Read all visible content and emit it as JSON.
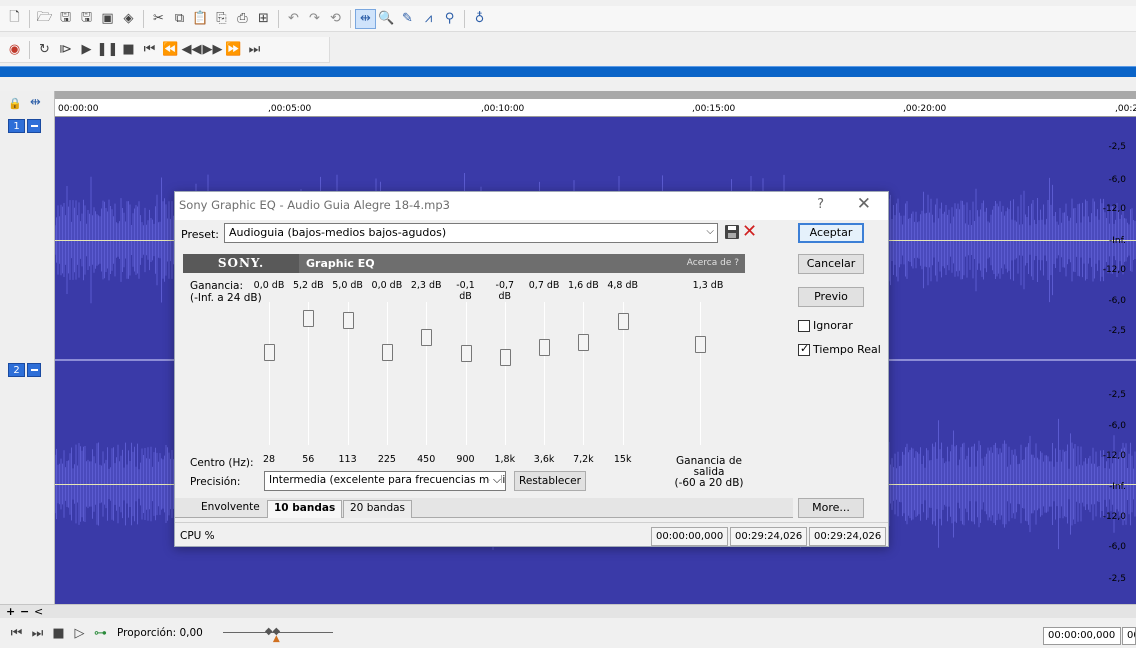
{
  "toolbar1": {
    "icons": [
      "new-icon",
      "open-icon",
      "save-icon",
      "save-as-icon",
      "render-icon",
      "properties-icon",
      "cut-icon",
      "copy-icon",
      "paste-icon",
      "paste-insert-icon",
      "mix-icon",
      "crop-icon",
      "undo-icon",
      "redo-icon",
      "undo-history-icon",
      "edit-tool-icon",
      "zoom-tool-icon",
      "pencil-tool-icon",
      "envelope-tool-icon",
      "region-icon",
      "marker-icon"
    ]
  },
  "toolbar2": {
    "icons": [
      "record-icon",
      "loop-icon",
      "play-all-icon",
      "play-icon",
      "pause-icon",
      "stop-icon",
      "go-start-icon",
      "prev-marker-icon",
      "rewind-icon",
      "forward-icon",
      "next-marker-icon",
      "go-end-icon"
    ]
  },
  "ruler": {
    "labels": [
      "00:00:00",
      ",00:05:00",
      ",00:10:00",
      ",00:15:00",
      ",00:20:00",
      ",00:2"
    ]
  },
  "channels": [
    {
      "number": "1",
      "db_labels": [
        "-2,5",
        "-6,0",
        "-12,0",
        "-Inf.",
        "-12,0",
        "-6,0",
        "-2,5"
      ]
    },
    {
      "number": "2",
      "db_labels": [
        "-2,5",
        "-6,0",
        "-12,0",
        "-Inf.",
        "-12,0",
        "-6,0",
        "-2,5"
      ]
    }
  ],
  "dialog": {
    "title": "Sony Graphic EQ - Audio Guia Alegre 18-4.mp3",
    "help_glyph": "?",
    "close_glyph": "✕",
    "preset_label": "Preset:",
    "preset_value": "Audioguia (bajos-medios bajos-agudos)",
    "buttons": {
      "accept": "Aceptar",
      "cancel": "Cancelar",
      "preview": "Previo",
      "more": "More..."
    },
    "checkboxes": {
      "ignore": {
        "label": "Ignorar",
        "checked": false
      },
      "realtime": {
        "label": "Tiempo Real",
        "checked": true
      }
    },
    "plugin": {
      "brand": "SONY.",
      "name": "Graphic EQ",
      "about": "Acerca de  ?",
      "gain_label_1": "Ganancia:",
      "gain_label_2": "(-Inf. a 24 dB)",
      "bands": [
        {
          "gain": "0,0 dB",
          "gain_value": 0.0,
          "freq": "28"
        },
        {
          "gain": "5,2 dB",
          "gain_value": 5.2,
          "freq": "56"
        },
        {
          "gain": "5,0 dB",
          "gain_value": 5.0,
          "freq": "113"
        },
        {
          "gain": "0,0 dB",
          "gain_value": 0.0,
          "freq": "225"
        },
        {
          "gain": "2,3 dB",
          "gain_value": 2.3,
          "freq": "450"
        },
        {
          "gain": "-0,1 dB",
          "gain_value": -0.1,
          "freq": "900"
        },
        {
          "gain": "-0,7 dB",
          "gain_value": -0.7,
          "freq": "1,8k"
        },
        {
          "gain": "0,7 dB",
          "gain_value": 0.7,
          "freq": "3,6k"
        },
        {
          "gain": "1,6 dB",
          "gain_value": 1.6,
          "freq": "7,2k"
        },
        {
          "gain": "4,8 dB",
          "gain_value": 4.8,
          "freq": "15k"
        }
      ],
      "output_gain": "1,3 dB",
      "output_gain_value": 1.3,
      "output_label_1": "Ganancia de",
      "output_label_2": "salida",
      "output_label_3": "(-60 a 20 dB)",
      "centro_label": "Centro (Hz):",
      "precision_label": "Precisión:",
      "precision_value": "Intermedia (excelente para frecuencias medias",
      "reset_button": "Restablecer"
    },
    "tabs": [
      "Envolvente",
      "10 bandas",
      "20 bandas"
    ],
    "active_tab": "10 bandas",
    "status": {
      "cpu": "CPU %",
      "time1": "00:00:00,000",
      "time2": "00:29:24,026",
      "time3": "00:29:24,026"
    }
  },
  "bottom": {
    "zoom_plus": "+",
    "zoom_minus": "−",
    "scroll_left": "<",
    "ratio_label": "Proporción: 0,00",
    "time_left": "00:00:00,000",
    "time_right": "00:"
  },
  "colors": {
    "waveform_bg": "#3a3aa8",
    "accent_blue": "#0a64c8",
    "delete_red": "#d02020"
  }
}
